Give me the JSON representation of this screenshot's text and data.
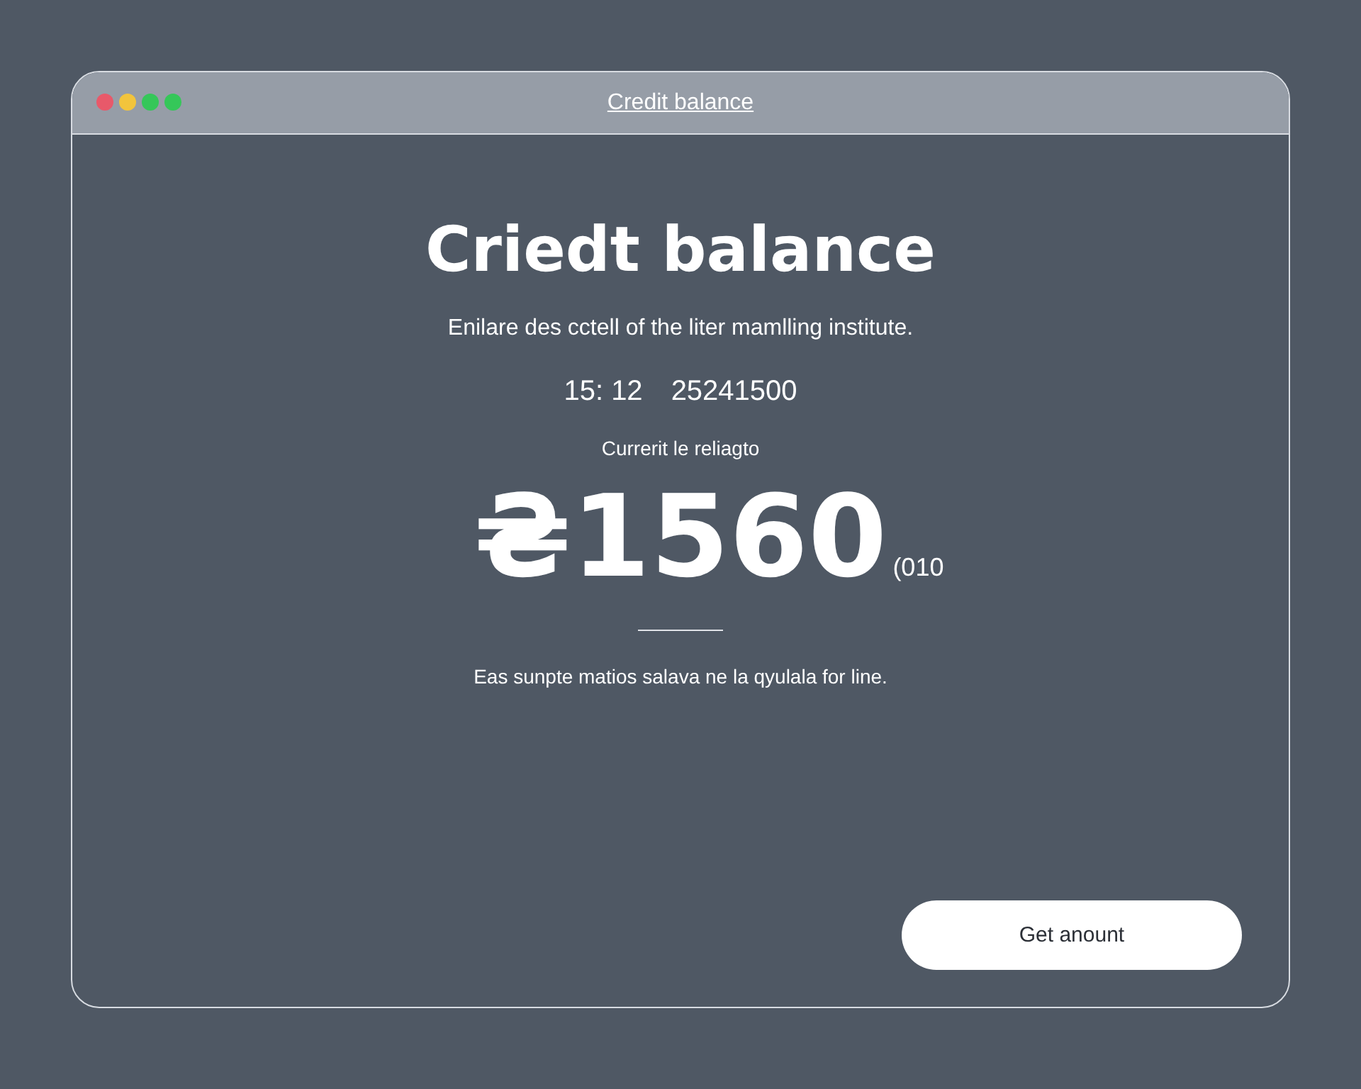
{
  "window": {
    "title": "Credit balance",
    "controls": [
      {
        "color": "#e8596a"
      },
      {
        "color": "#f2c43c"
      },
      {
        "color": "#35c759"
      },
      {
        "color": "#35c759"
      }
    ]
  },
  "heading": "Criedt balance",
  "subtitle": "Enilare des cctell of the liter mamlling institute.",
  "time": "15: 12",
  "number": "25241500",
  "label": "Currerit le reliagto",
  "amount": "₴1560",
  "amount_suffix": "(010",
  "note": "Eas sunpte matios salava ne la qyulala for line.",
  "button": "Get anount"
}
